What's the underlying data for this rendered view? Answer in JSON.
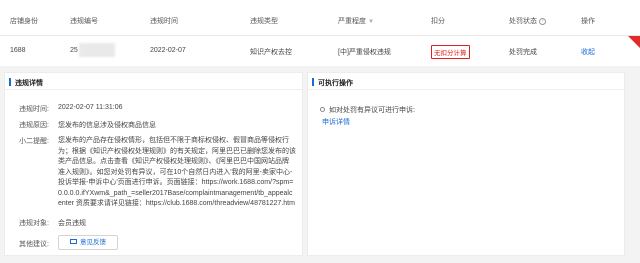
{
  "table": {
    "headers": {
      "shop_identity": "店铺身份",
      "violation_no": "违规编号",
      "violation_time": "违规时间",
      "violation_type": "违规类型",
      "severity": "严重程度",
      "deduction": "扣分",
      "penalty_status": "处罚状态",
      "actions": "操作"
    },
    "row": {
      "shop_identity": "1688",
      "violation_no": "25",
      "violation_time": "2022-02-07",
      "violation_type": "知识产权去控",
      "severity": "[中]严重侵权违规",
      "deduction": "无扣分计算",
      "penalty_status": "处罚完成",
      "action": "收起"
    }
  },
  "details": {
    "title": "违规详情",
    "time_label": "违规时间:",
    "time_value": "2022-02-07 11:31:06",
    "reason_label": "违规原因:",
    "reason_value": "您发布的信息涉及侵权商品信息",
    "tip_label": "小二提醒:",
    "tip_lines": [
      "您发布的产品存在侵权情形，包括但不限于商标权侵权、假冒商品等侵权行",
      "为；根据《知识产权侵权处理规则》的有关规定，阿里巴巴已删除您发布的该",
      "类产品信息。点击查看《知识产权侵权处理规则》、《阿里巴巴中国网站品牌",
      "准入规则》。如您对处罚有异议，可在10个自然日内进入'我的阿里-卖家中心-",
      "投诉举报-申诉中心'页面进行申诉。页面链接：https://work.1688.com/?spm=",
      "0.0.0.0.ifYXwm&_path_=seller2017Base/complaintmanagement/tb_appealc",
      "enter 资质要求请详见链接：https://club.1688.com/threadview/48781227.htm"
    ],
    "target_label": "违规对象:",
    "target_value": "会员违规",
    "suggest_label": "其他建议:",
    "feedback_button": "意见反馈"
  },
  "operations": {
    "title": "可执行操作",
    "item_text": "如对处罚有异议可进行申诉:",
    "item_link": "申诉详情"
  },
  "icons": {
    "sort": "sort-icon",
    "question": "question-icon",
    "mail": "mail-icon"
  },
  "colors": {
    "link": "#1a6ad6",
    "danger": "#e02020",
    "panel_bg": "#f3f3f3"
  }
}
